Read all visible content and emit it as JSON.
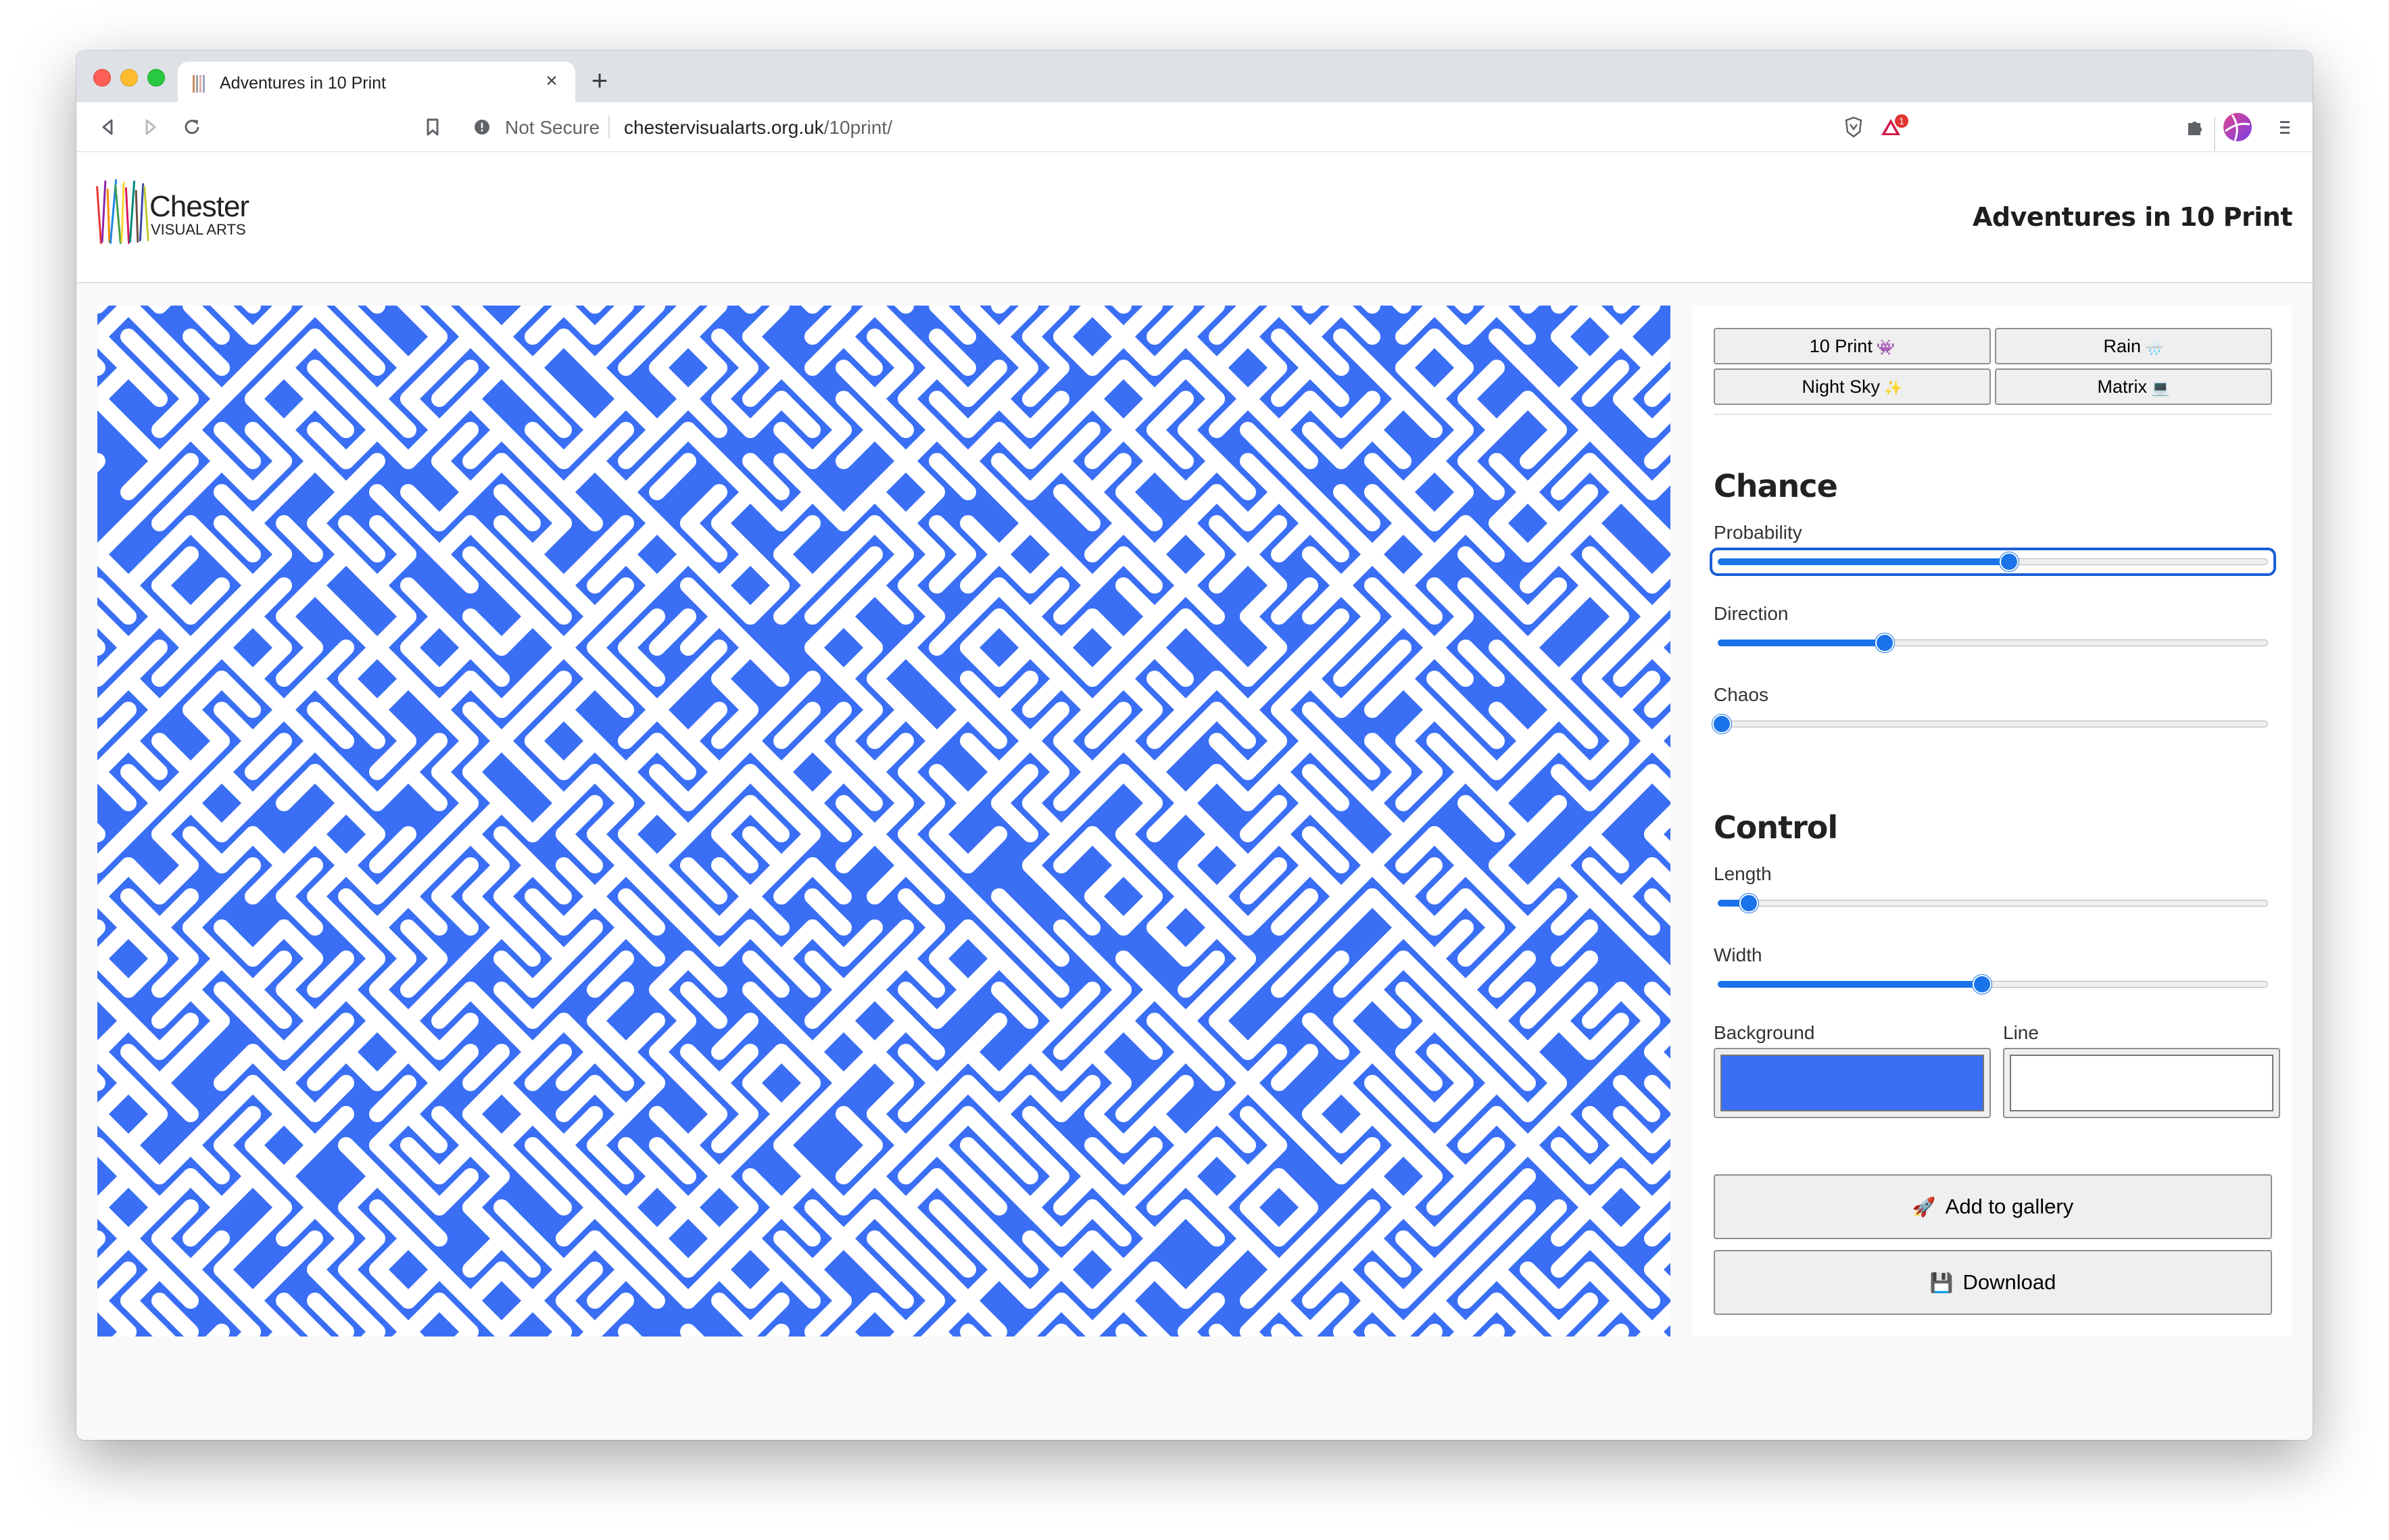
{
  "browser": {
    "tab_title": "Adventures in 10 Print",
    "security_label": "Not Secure",
    "url_domain": "chestervisualarts.org.uk",
    "url_path": "/10print/",
    "extension_badge": "1"
  },
  "site": {
    "logo_name": "Chester",
    "logo_sub": "VISUAL ARTS",
    "title": "Adventures in 10 Print"
  },
  "artwork": {
    "background_color": "#3a6ff5",
    "line_color": "#ffffff"
  },
  "presets": [
    {
      "label": "10 Print",
      "emoji": "👾"
    },
    {
      "label": "Rain",
      "emoji": "🌧️"
    },
    {
      "label": "Night Sky",
      "emoji": "✨"
    },
    {
      "label": "Matrix",
      "emoji": "💻"
    }
  ],
  "chance": {
    "title": "Chance",
    "probability": {
      "label": "Probability",
      "value": 0.53
    },
    "direction": {
      "label": "Direction",
      "value": 0.3
    },
    "chaos": {
      "label": "Chaos",
      "value": 0.0
    }
  },
  "control": {
    "title": "Control",
    "length": {
      "label": "Length",
      "value": 0.05
    },
    "width": {
      "label": "Width",
      "value": 0.48
    },
    "background": {
      "label": "Background",
      "value": "#3a6ff5"
    },
    "line": {
      "label": "Line",
      "value": "#ffffff"
    }
  },
  "actions": {
    "gallery": {
      "label": "Add to gallery",
      "icon": "rocket-icon"
    },
    "download": {
      "label": "Download",
      "icon": "floppy-disk-icon"
    }
  }
}
